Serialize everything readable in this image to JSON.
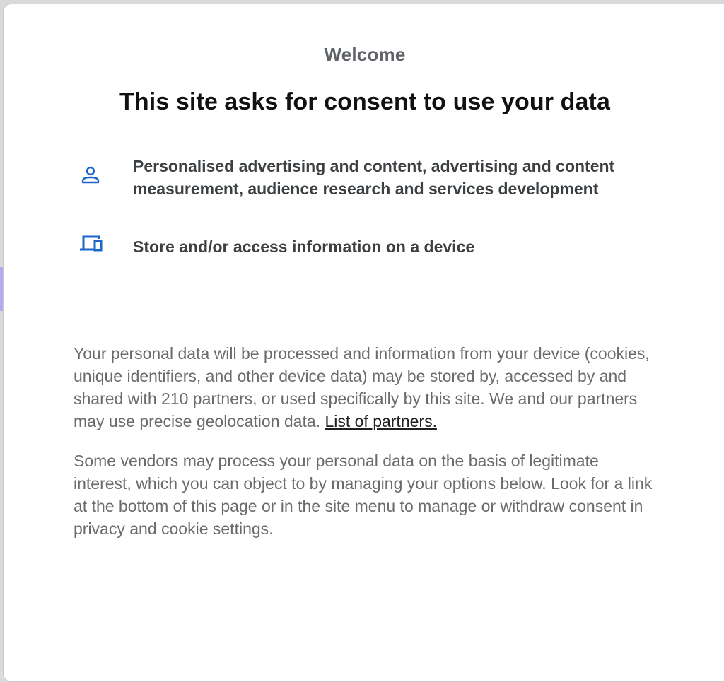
{
  "dialog": {
    "welcome": "Welcome",
    "headline": "This site asks for consent to use your data",
    "purposes": [
      {
        "icon": "person-icon",
        "text": "Personalised advertising and content, advertising and content measurement, audience research and services development"
      },
      {
        "icon": "devices-icon",
        "text": "Store and/or access information on a device"
      }
    ],
    "paragraph1": "Your personal data will be processed and information from your device (cookies, unique identifiers, and other device data) may be stored by, accessed by and shared with 210 partners, or used specifically by this site. We and our partners may use precise geolocation data.",
    "partners_link": "List of partners.",
    "paragraph2": "Some vendors may process your personal data on the basis of legitimate interest, which you can object to by managing your options below. Look for a link at the bottom of this page or in the site menu to manage or withdraw consent in privacy and cookie settings."
  },
  "colors": {
    "icon": "#1a66c9",
    "heading": "#111111",
    "muted": "#6b6b6b",
    "link": "#1f1f1f"
  }
}
